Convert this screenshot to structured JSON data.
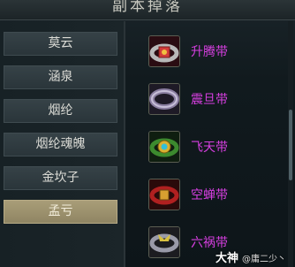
{
  "window": {
    "title": "副本掉落"
  },
  "tabs": [
    {
      "label": "莫云",
      "active": false
    },
    {
      "label": "涵泉",
      "active": false
    },
    {
      "label": "烟纶",
      "active": false
    },
    {
      "label": "烟纶魂魄",
      "active": false
    },
    {
      "label": "金坎子",
      "active": false
    },
    {
      "label": "孟亏",
      "active": true
    }
  ],
  "drops": [
    {
      "label": "升腾带",
      "icon": "belt-icon"
    },
    {
      "label": "震旦带",
      "icon": "belt-icon"
    },
    {
      "label": "飞天带",
      "icon": "belt-icon"
    },
    {
      "label": "空蝉带",
      "icon": "belt-icon"
    },
    {
      "label": "六祸带",
      "icon": "belt-icon"
    }
  ],
  "watermark": {
    "brand": "大神",
    "user": "@庸二少丶"
  },
  "colors": {
    "item_name": "#d63fe0",
    "active_tab": "#a99d78"
  }
}
